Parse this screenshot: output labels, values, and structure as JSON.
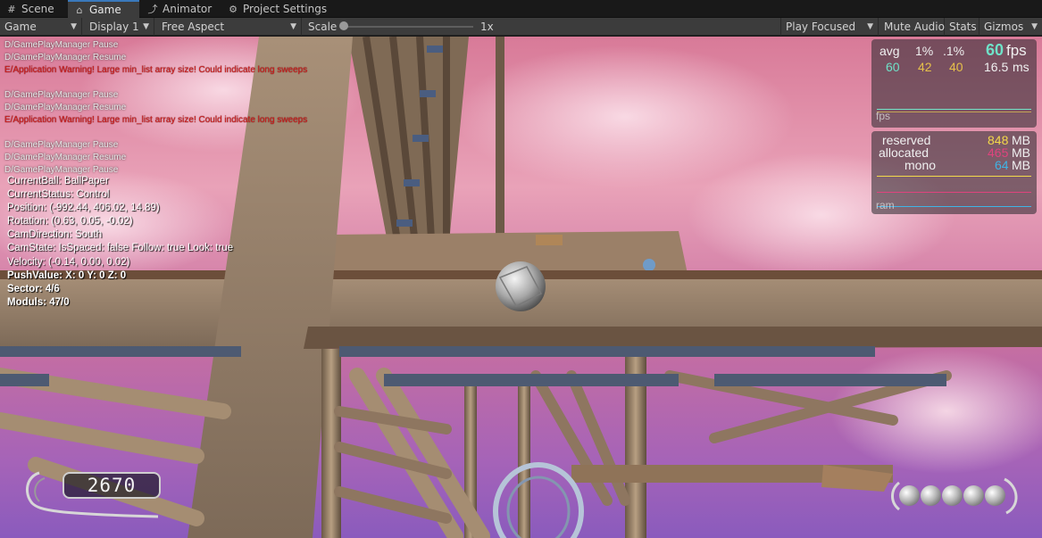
{
  "tabs": [
    {
      "label": "Scene",
      "icon": "grid-icon"
    },
    {
      "label": "Game",
      "icon": "gamepad-icon",
      "active": true
    },
    {
      "label": "Animator",
      "icon": "animator-icon"
    },
    {
      "label": "Project Settings",
      "icon": "gear-icon"
    }
  ],
  "toolbar": {
    "view_select": "Game",
    "display_select": "Display 1",
    "aspect_select": "Free Aspect",
    "scale_label": "Scale",
    "scale_value": "1x",
    "scale_fraction": 0.0,
    "play_mode_select": "Play Focused",
    "mute_audio": "Mute Audio",
    "stats": "Stats",
    "gizmos": "Gizmos"
  },
  "log": {
    "line1": "D/GamePlayManager Pause",
    "line2": "D/GamePlayManager Resume",
    "line3": "E/Application Warning! Large min_list array size! Could indicate long sweeps",
    "line4": "D/GamePlayManager Pause",
    "line5": "D/GamePlayManager Resume",
    "line6": "E/Application Warning! Large min_list array size! Could indicate long sweeps",
    "line7": "D/GamePlayManager Pause",
    "line8": "D/GamePlayManager Resume",
    "line9": "D/GamePlayManager Pause"
  },
  "status": {
    "current_ball": "CurrentBall: BallPaper",
    "current_status": "CurrentStatus: Control",
    "position": "Position: (-992.44, 406.02, 14.89)",
    "rotation": "Rotation: (0.63, 0.05, -0.02)",
    "cam_direction": "CamDirection: South",
    "cam_state": "CamState: IsSpaced: false Follow: true Look: true",
    "velocity": "Velocity: (-0.14, 0.00, 0.02)",
    "push_value": "PushValue: X: 0 Y: 0 Z: 0",
    "sector": "Sector: 4/6",
    "moduls": "Moduls: 47/0"
  },
  "fps_panel": {
    "avg_label": "avg",
    "p1_label": "1%",
    "p01_label": ".1%",
    "fps_value": "60",
    "fps_unit": "fps",
    "avg_value": "60",
    "p1_value": "42",
    "p01_value": "40",
    "ms_value": "16.5",
    "ms_unit": "ms",
    "graph_label": "fps",
    "colors": {
      "fps": "#6fe2c8",
      "avg": "#6fe2c8",
      "p1": "#e6c04a",
      "p01": "#e6c04a",
      "ms": "#f0f0f0"
    }
  },
  "ram_panel": {
    "reserved_label": "reserved",
    "allocated_label": "allocated",
    "mono_label": "mono",
    "reserved_value": "848",
    "allocated_value": "465",
    "mono_value": "64",
    "unit": "MB",
    "graph_label": "ram",
    "colors": {
      "reserved": "#f3d94a",
      "allocated": "#e0437e",
      "mono": "#3fb4e6"
    }
  },
  "hud": {
    "score": "2670",
    "lives_count": 5
  }
}
